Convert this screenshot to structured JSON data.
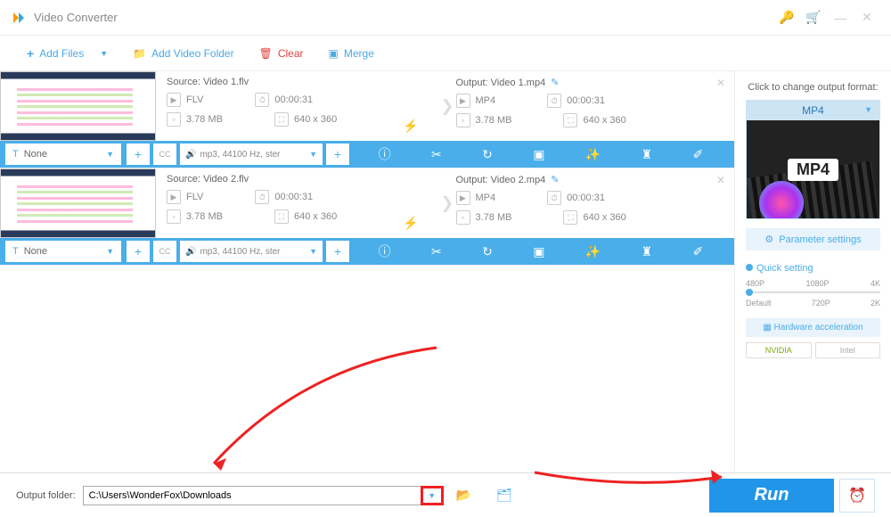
{
  "app": {
    "title": "Video Converter"
  },
  "toolbar": {
    "add_files": "Add Files",
    "add_folder": "Add Video Folder",
    "clear": "Clear",
    "merge": "Merge"
  },
  "items": [
    {
      "source": {
        "label": "Source: Video 1.flv",
        "format": "FLV",
        "duration": "00:00:31",
        "size": "3.78 MB",
        "dims": "640 x 360"
      },
      "output": {
        "label": "Output: Video 1.mp4",
        "format": "MP4",
        "duration": "00:00:31",
        "size": "3.78 MB",
        "dims": "640 x 360"
      },
      "subtitle": "None",
      "audio": "mp3, 44100 Hz, ster"
    },
    {
      "source": {
        "label": "Source: Video 2.flv",
        "format": "FLV",
        "duration": "00:00:31",
        "size": "3.78 MB",
        "dims": "640 x 360"
      },
      "output": {
        "label": "Output: Video 2.mp4",
        "format": "MP4",
        "duration": "00:00:31",
        "size": "3.78 MB",
        "dims": "640 x 360"
      },
      "subtitle": "None",
      "audio": "mp3, 44100 Hz, ster"
    }
  ],
  "sidebar": {
    "header": "Click to change output format:",
    "format": "MP4",
    "format_badge": "MP4",
    "param": "Parameter settings",
    "quick": "Quick setting",
    "res": [
      "480P",
      "1080P",
      "4K",
      "Default",
      "720P",
      "2K"
    ],
    "hw": "Hardware acceleration",
    "nvidia": "NVIDIA",
    "intel": "Intel"
  },
  "bottom": {
    "label": "Output folder:",
    "path": "C:\\Users\\WonderFox\\Downloads",
    "run": "Run"
  }
}
